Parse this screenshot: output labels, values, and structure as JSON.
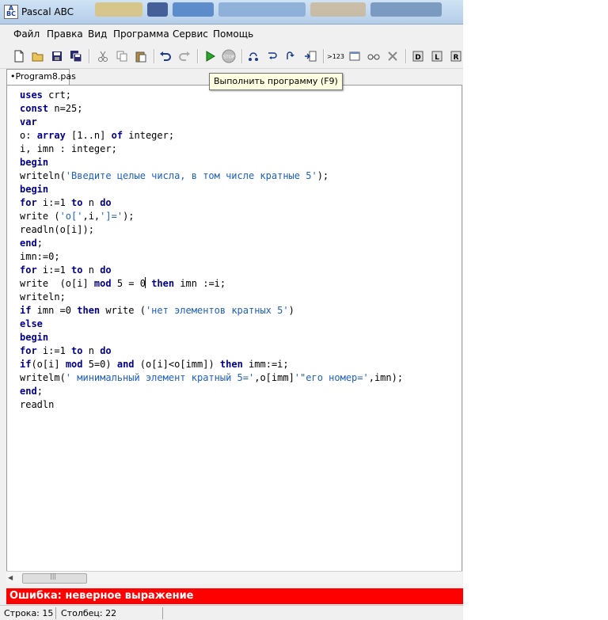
{
  "window": {
    "title": "Pascal ABC"
  },
  "menu": [
    "Файл",
    "Правка",
    "Вид",
    "Программа",
    "Сервис",
    "Помощь"
  ],
  "toolbar": {
    "tooltip": "Выполнить программу (F9)",
    "counter_label": ">123",
    "stop_label": "STOP"
  },
  "tab": {
    "label": "•Program8.pas"
  },
  "code_lines": [
    [
      [
        "kw",
        "uses"
      ],
      [
        "",
        "&nbsp;crt;"
      ]
    ],
    [
      [
        "kw",
        "const"
      ],
      [
        "",
        "&nbsp;n=25;"
      ]
    ],
    [
      [
        "kw",
        "var"
      ]
    ],
    [
      [
        "",
        "o:&nbsp;"
      ],
      [
        "kw",
        "array"
      ],
      [
        "",
        "&nbsp;[1..n]&nbsp;"
      ],
      [
        "kw",
        "of"
      ],
      [
        "",
        "&nbsp;integer;"
      ]
    ],
    [
      [
        "",
        "i,&nbsp;imn&nbsp;:&nbsp;integer;"
      ]
    ],
    [
      [
        "kw",
        "begin"
      ]
    ],
    [
      [
        "",
        "writeln("
      ],
      [
        "str",
        "'Введите целые числа, в том числе кратные 5'"
      ],
      [
        "",
        ");"
      ]
    ],
    [
      [
        "kw",
        "begin"
      ]
    ],
    [
      [
        "kw",
        "for"
      ],
      [
        "",
        "&nbsp;i:=1&nbsp;"
      ],
      [
        "kw",
        "to"
      ],
      [
        "",
        "&nbsp;n&nbsp;"
      ],
      [
        "kw",
        "do"
      ]
    ],
    [
      [
        "",
        "write&nbsp;("
      ],
      [
        "str",
        "'o['"
      ],
      [
        "",
        ",i,"
      ],
      [
        "str",
        "']='"
      ],
      [
        "",
        ");"
      ]
    ],
    [
      [
        "",
        "readln(o[i]);"
      ]
    ],
    [
      [
        "kw",
        "end"
      ],
      [
        "",
        ";"
      ]
    ],
    [
      [
        "",
        "imn:=0;"
      ]
    ],
    [
      [
        "kw",
        "for"
      ],
      [
        "",
        "&nbsp;i:=1&nbsp;"
      ],
      [
        "kw",
        "to"
      ],
      [
        "",
        "&nbsp;n&nbsp;"
      ],
      [
        "kw",
        "do"
      ]
    ],
    [
      [
        "",
        "write&nbsp;&nbsp;(o[i]&nbsp;"
      ],
      [
        "kw",
        "mod"
      ],
      [
        "",
        "&nbsp;5&nbsp;=&nbsp;0"
      ],
      [
        "caret",
        ""
      ],
      [
        "",
        "&nbsp;"
      ],
      [
        "kw",
        "then"
      ],
      [
        "",
        "&nbsp;imn&nbsp;:=i;"
      ]
    ],
    [
      [
        "",
        "writeln;"
      ]
    ],
    [
      [
        "kw",
        "if"
      ],
      [
        "",
        "&nbsp;imn&nbsp;=0&nbsp;"
      ],
      [
        "kw",
        "then"
      ],
      [
        "",
        "&nbsp;write&nbsp;("
      ],
      [
        "str",
        "'нет элементов кратных 5'"
      ],
      [
        "",
        ")"
      ]
    ],
    [
      [
        "kw",
        "else"
      ]
    ],
    [
      [
        "kw",
        "begin"
      ]
    ],
    [
      [
        "kw",
        "for"
      ],
      [
        "",
        "&nbsp;i:=1&nbsp;"
      ],
      [
        "kw",
        "to"
      ],
      [
        "",
        "&nbsp;n&nbsp;"
      ],
      [
        "kw",
        "do"
      ]
    ],
    [
      [
        "kw",
        "if"
      ],
      [
        "",
        "(o[i]&nbsp;"
      ],
      [
        "kw",
        "mod"
      ],
      [
        "",
        "&nbsp;5=0)&nbsp;"
      ],
      [
        "kw",
        "and"
      ],
      [
        "",
        "&nbsp;(o[i]&lt;o[imm])&nbsp;"
      ],
      [
        "kw",
        "then"
      ],
      [
        "",
        "&nbsp;imm:=i;"
      ]
    ],
    [
      [
        "",
        "writelm("
      ],
      [
        "str",
        "' минимальный элемент кратный 5='"
      ],
      [
        "",
        ",o[imm]"
      ],
      [
        "str",
        "'\"его номер='"
      ],
      [
        "",
        ",imn);"
      ]
    ],
    [
      [
        "kw",
        "end"
      ],
      [
        "",
        ";"
      ]
    ],
    [
      [
        "",
        "readln"
      ]
    ]
  ],
  "error": {
    "message": "Ошибка: неверное выражение",
    "color": "#ff0000"
  },
  "status": {
    "line": "Строка: 15",
    "column": "Столбец: 22"
  }
}
